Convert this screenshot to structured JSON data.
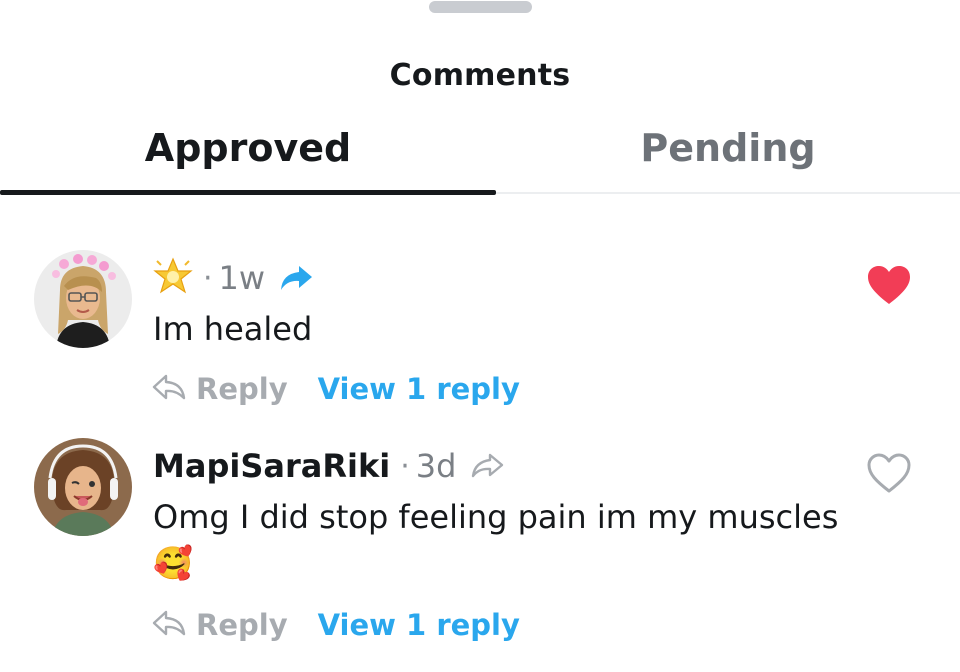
{
  "header": {
    "title": "Comments"
  },
  "tabs": [
    {
      "label": "Approved",
      "active": true
    },
    {
      "label": "Pending",
      "active": false
    }
  ],
  "comments": [
    {
      "username": "",
      "badge_icon": "sparkle-star-icon",
      "separator": "·",
      "time": "1w",
      "shared": true,
      "text": "Im healed",
      "liked": true,
      "reply_label": "Reply",
      "view_replies_label": "View 1 reply"
    },
    {
      "username": "MapiSaraRiki",
      "separator": "·",
      "time": "3d",
      "shared": false,
      "text": "Omg I did stop feeling pain im my muscles",
      "emoji": "🥰",
      "liked": false,
      "reply_label": "Reply",
      "view_replies_label": "View 1 reply"
    }
  ],
  "colors": {
    "like_active": "#f23d56",
    "link": "#2aa7ed",
    "share_active": "#2aa7ed",
    "muted": "#a7abb0"
  }
}
